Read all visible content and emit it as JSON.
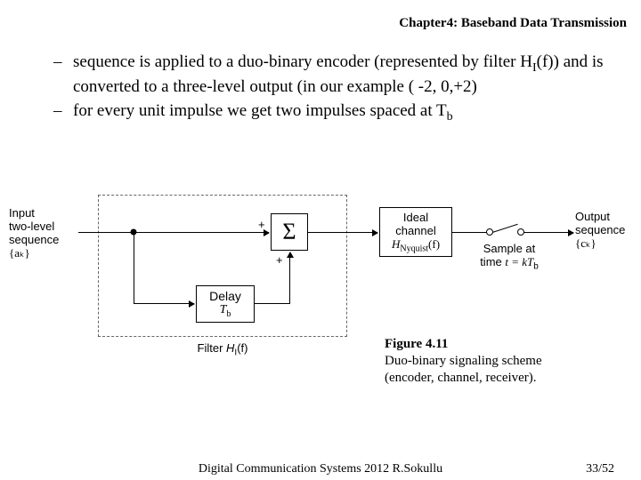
{
  "header": "Chapter4: Baseband Data Transmission",
  "bullets": {
    "b1_pre": "sequence is applied to a duo-binary encoder (represented by filter H",
    "b1_sub": "I",
    "b1_post": "(f)) and is converted to a three-level output (in our example ( -2, 0,+2)",
    "b2_pre": "for every unit impulse we get two impulses spaced at T",
    "b2_sub": "b"
  },
  "diagram": {
    "input_l1": "Input",
    "input_l2": "two-level",
    "input_l3": "sequence",
    "input_seq": "{aₖ}",
    "sigma": "Σ",
    "plus1": "+",
    "plus2": "+",
    "delay_l1": "Delay",
    "delay_l2": "T_b",
    "filter_label_pre": "Filter ",
    "filter_label_h": "H",
    "filter_label_sub": "I",
    "filter_label_post": "(f)",
    "ideal_l1": "Ideal",
    "ideal_l2": "channel",
    "ideal_l3_h": "H",
    "ideal_l3_sub": "Nyquist",
    "ideal_l3_post": "(f)",
    "sample_l1": "Sample at",
    "sample_l2_pre": "time ",
    "sample_l2_var": "t = kT",
    "sample_l2_sub": "b",
    "output_l1": "Output",
    "output_l2": "sequence",
    "output_seq": "{cₖ}"
  },
  "caption": {
    "title": "Figure 4.11",
    "body": "Duo-binary signaling scheme (encoder, channel, receiver)."
  },
  "footer": {
    "center": "Digital Communication Systems 2012 R.Sokullu",
    "right": "33/52"
  }
}
